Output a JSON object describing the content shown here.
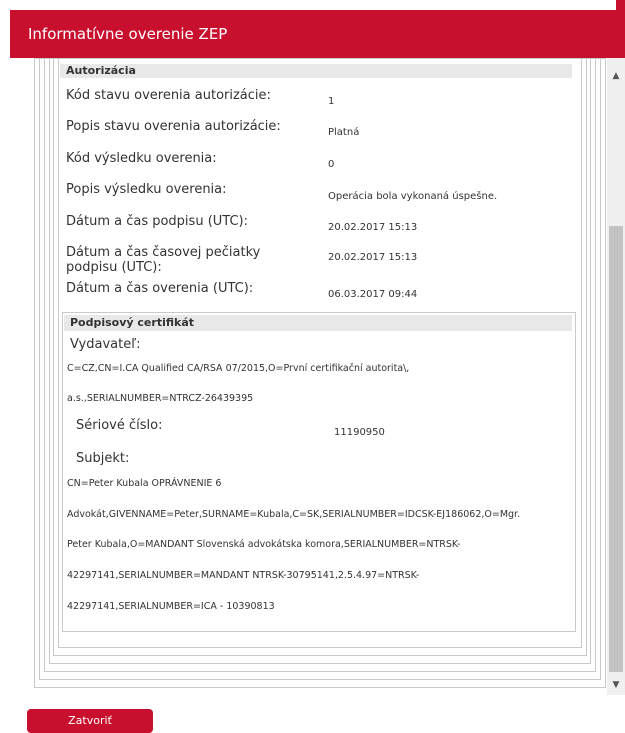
{
  "dialog": {
    "title": "Informatívne overenie ZEP",
    "close_label": "Zatvoriť"
  },
  "authorization": {
    "section_title": "Autorizácia",
    "rows": [
      {
        "label": "Kód stavu overenia autorizácie:",
        "value": "1"
      },
      {
        "label": "Popis stavu overenia autorizácie:",
        "value": "Platná"
      },
      {
        "label": "Kód výsledku overenia:",
        "value": "0"
      },
      {
        "label": "Popis výsledku overenia:",
        "value": "Operácia bola vykonaná úspešne."
      },
      {
        "label": "Dátum a čas podpisu (UTC):",
        "value": "20.02.2017 15:13"
      },
      {
        "label": "Dátum a čas časovej pečiatky podpisu (UTC):",
        "value": "20.02.2017 15:13"
      },
      {
        "label": "Dátum a čas overenia (UTC):",
        "value": "06.03.2017 09:44"
      }
    ]
  },
  "certificate": {
    "section_title": "Podpisový certifikát",
    "issuer_label": "Vydavateľ:",
    "issuer_lines": [
      "C=CZ,CN=I.CA Qualified CA/RSA 07/2015,O=První certifikační autorita\\,",
      "a.s.,SERIALNUMBER=NTRCZ-26439395"
    ],
    "serial_label": "Sériové číslo:",
    "serial_value": "11190950",
    "subject_label": "Subjekt:",
    "subject_lines": [
      "CN=Peter Kubala OPRÁVNENIE 6",
      "Advokát,GIVENNAME=Peter,SURNAME=Kubala,C=SK,SERIALNUMBER=IDCSK-EJ186062,O=Mgr.",
      "Peter Kubala,O=MANDANT Slovenská advokátska komora,SERIALNUMBER=NTRSK-",
      "42297141,SERIALNUMBER=MANDANT NTRSK-30795141,2.5.4.97=NTRSK-",
      "42297141,SERIALNUMBER=ICA - 10390813"
    ]
  },
  "colors": {
    "brand_red": "#c8102e",
    "section_header_bg": "#e8e8e8",
    "border": "#c9c9c9"
  }
}
